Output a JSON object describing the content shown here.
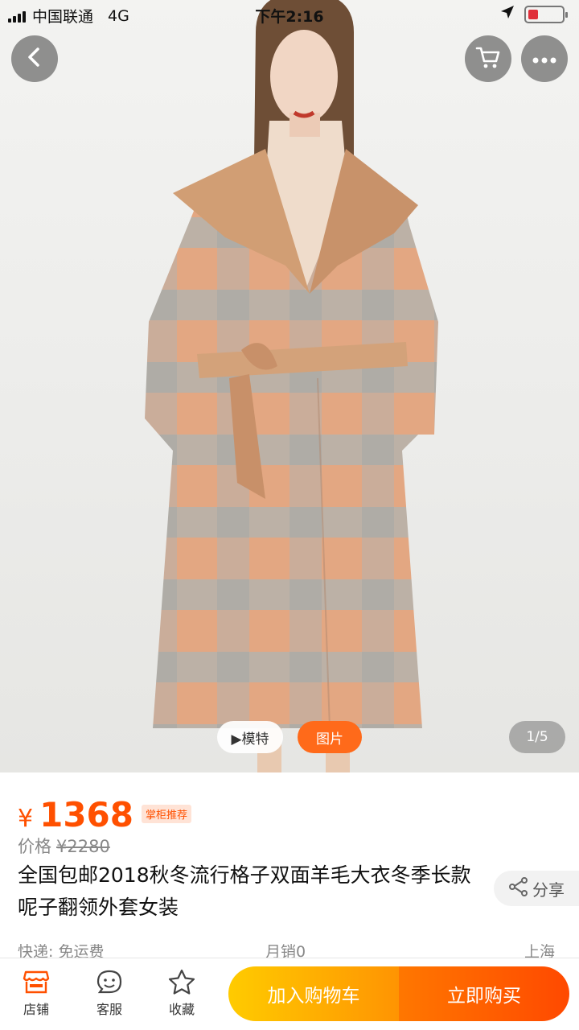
{
  "status_bar": {
    "carrier": "中国联通",
    "network": "4G",
    "time": "下午2:16",
    "battery_level": 0.3
  },
  "hero": {
    "model_label": "▶模特",
    "photo_label": "图片",
    "page_indicator": "1/5"
  },
  "price": {
    "currency": "¥",
    "amount": "1368",
    "tag": "掌柜推荐",
    "original_label": "价格",
    "original_price": "¥2280"
  },
  "product": {
    "title": "全国包邮2018秋冬流行格子双面羊毛大衣冬季长款呢子翻领外套女装",
    "share_label": "分享"
  },
  "meta": {
    "shipping": "快递: 免运费",
    "monthly_sales": "月销0",
    "location": "上海"
  },
  "bottom_bar": {
    "shop_label": "店铺",
    "service_label": "客服",
    "favorite_label": "收藏",
    "add_to_cart": "加入购物车",
    "buy_now": "立即购买"
  },
  "colors": {
    "accent": "#ff5000",
    "cart_gradient": [
      "#ffcb00",
      "#ff9402"
    ],
    "buy_gradient": [
      "#ff7700",
      "#ff4900"
    ]
  }
}
